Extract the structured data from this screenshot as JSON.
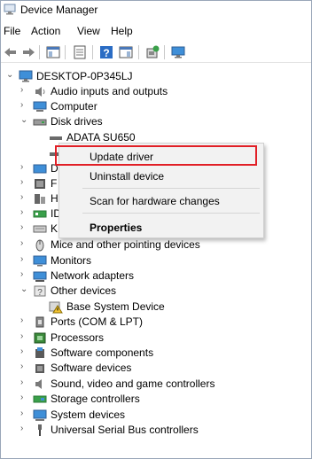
{
  "window": {
    "title": "Device Manager"
  },
  "menu": [
    "File",
    "Action",
    "View",
    "Help"
  ],
  "toolbar": {
    "buttons": [
      "back-arrow-icon",
      "forward-arrow-icon",
      "show-hide-console-tree-icon",
      "properties-icon",
      "help-icon",
      "action-pane-icon",
      "scan-hardware-icon",
      "monitor-icon"
    ]
  },
  "tree": {
    "root": "DESKTOP-0P345LJ",
    "items": [
      {
        "label": "Audio inputs and outputs",
        "icon": "speaker-icon"
      },
      {
        "label": "Computer",
        "icon": "computer-icon"
      },
      {
        "label": "Disk drives",
        "icon": "disk-drive-icon",
        "expanded": true
      },
      {
        "label": "ADATA SU650",
        "icon": "disk-icon",
        "child": true
      },
      {
        "label": "",
        "icon": "disk-icon",
        "child": true
      },
      {
        "label": "D",
        "icon": "display-adapter-icon"
      },
      {
        "label": "F",
        "icon": "firmware-icon"
      },
      {
        "label": "H",
        "icon": "hid-icon"
      },
      {
        "label": "ID",
        "icon": "ide-icon"
      },
      {
        "label": "K",
        "icon": "keyboard-icon"
      },
      {
        "label": "Mice and other pointing devices",
        "icon": "mouse-icon"
      },
      {
        "label": "Monitors",
        "icon": "monitor-icon"
      },
      {
        "label": "Network adapters",
        "icon": "network-icon"
      },
      {
        "label": "Other devices",
        "icon": "unknown-device-icon",
        "expanded": true
      },
      {
        "label": "Base System Device",
        "icon": "warning-device-icon",
        "child": true
      },
      {
        "label": "Ports (COM & LPT)",
        "icon": "port-icon"
      },
      {
        "label": "Processors",
        "icon": "processor-icon"
      },
      {
        "label": "Software components",
        "icon": "software-component-icon"
      },
      {
        "label": "Software devices",
        "icon": "software-device-icon"
      },
      {
        "label": "Sound, video and game controllers",
        "icon": "sound-icon"
      },
      {
        "label": "Storage controllers",
        "icon": "storage-controller-icon"
      },
      {
        "label": "System devices",
        "icon": "system-device-icon"
      },
      {
        "label": "Universal Serial Bus controllers",
        "icon": "usb-icon"
      }
    ]
  },
  "context_menu": {
    "items": [
      "Update driver",
      "Uninstall device",
      "Scan for hardware changes",
      "Properties"
    ],
    "highlighted": "Update driver"
  },
  "colors": {
    "highlight_border": "#e11f26",
    "accent_blue": "#2a6cc4"
  }
}
